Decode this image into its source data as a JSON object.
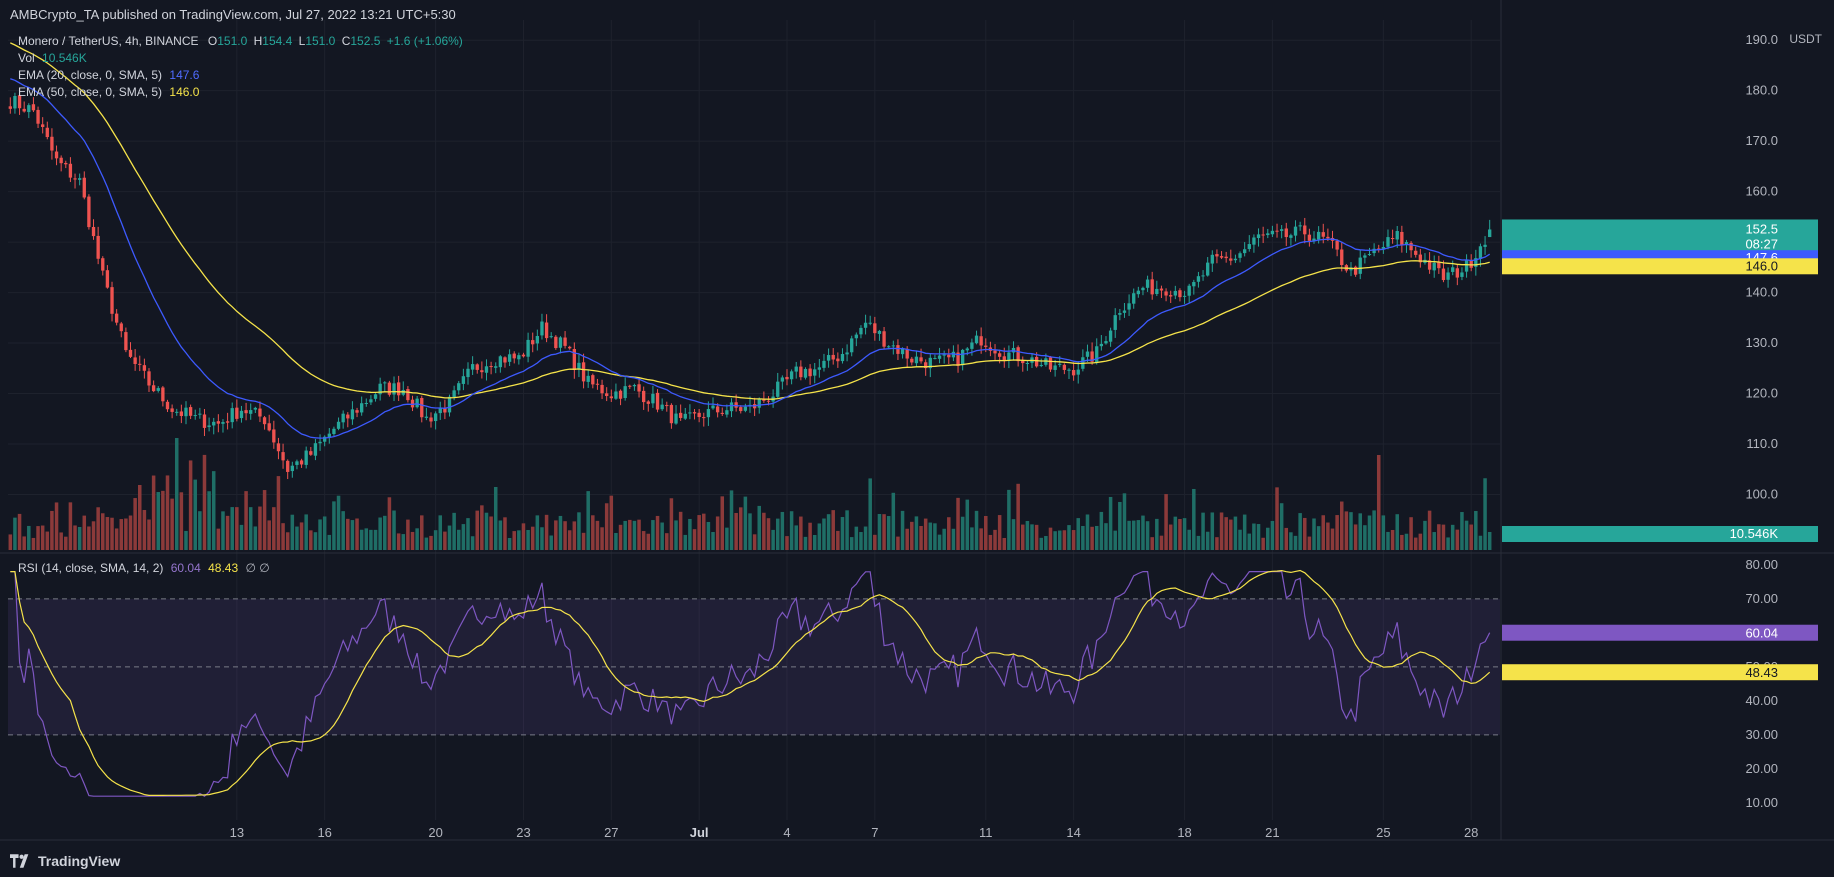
{
  "header": {
    "publisher_line": "AMBCrypto_TA published on TradingView.com, Jul 27, 2022 13:21 UTC+5:30"
  },
  "legend": {
    "symbol": "Monero / TetherUS, 4h, BINANCE",
    "O_label": "O",
    "O": "151.0",
    "H_label": "H",
    "H": "154.4",
    "L_label": "L",
    "L": "151.0",
    "C_label": "C",
    "C": "152.5",
    "change": "+1.6 (+1.06%)",
    "vol_label": "Vol",
    "vol": "10.546K",
    "ema20_label": "EMA (20, close, 0, SMA, 5)",
    "ema20": "147.6",
    "ema50_label": "EMA (50, close, 0, SMA, 5)",
    "ema50": "146.0",
    "rsi_label": "RSI (14, close, SMA, 14, 2)",
    "rsi": "60.04",
    "rsi_ma": "48.43",
    "rsi_extra": "∅ ∅"
  },
  "axis": {
    "currency": "USDT"
  },
  "price_badges": {
    "last": "152.5",
    "countdown": "08:27",
    "ema20": "147.6",
    "ema50": "146.0",
    "volume": "10.546K"
  },
  "rsi_badges": {
    "rsi": "60.04",
    "rsi_ma": "48.43"
  },
  "footer": {
    "brand": "TradingView"
  },
  "colors": {
    "up": "#26a69a",
    "down": "#ef5350",
    "ema20": "#3d5afe",
    "ema50": "#f5e34a",
    "rsi": "#7e57c2",
    "rsi_ma": "#f5e34a",
    "background": "#131722",
    "grid": "#1e222d",
    "text": "#b2b5be"
  },
  "chart_data": [
    {
      "type": "candlestick",
      "title": "Monero / TetherUS, 4h, BINANCE",
      "ylabel": "USDT",
      "ylim": [
        89,
        194
      ],
      "grid": true,
      "x_ticks": [
        "13",
        "16",
        "20",
        "23",
        "27",
        "Jul",
        "4",
        "7",
        "11",
        "14",
        "18",
        "21",
        "25",
        "28"
      ],
      "y_ticks": [
        100,
        110,
        120,
        130,
        140,
        150,
        160,
        170,
        180,
        190
      ],
      "anchors_close": [
        [
          0,
          178
        ],
        [
          5,
          176
        ],
        [
          10,
          166
        ],
        [
          15,
          162
        ],
        [
          20,
          143
        ],
        [
          25,
          128
        ],
        [
          30,
          122
        ],
        [
          35,
          117
        ],
        [
          40,
          115
        ],
        [
          45,
          114
        ],
        [
          50,
          117
        ],
        [
          55,
          115
        ],
        [
          60,
          105
        ],
        [
          65,
          108
        ],
        [
          70,
          113
        ],
        [
          75,
          117
        ],
        [
          80,
          121
        ],
        [
          85,
          121
        ],
        [
          90,
          115
        ],
        [
          95,
          118
        ],
        [
          100,
          125
        ],
        [
          105,
          127
        ],
        [
          110,
          127
        ],
        [
          115,
          133
        ],
        [
          120,
          129
        ],
        [
          125,
          122
        ],
        [
          130,
          120
        ],
        [
          135,
          121
        ],
        [
          140,
          118
        ],
        [
          145,
          114
        ],
        [
          150,
          116
        ],
        [
          155,
          117
        ],
        [
          160,
          117
        ],
        [
          165,
          120
        ],
        [
          170,
          124
        ],
        [
          175,
          125
        ],
        [
          180,
          128
        ],
        [
          185,
          134
        ],
        [
          190,
          130
        ],
        [
          195,
          127
        ],
        [
          200,
          126
        ],
        [
          205,
          127
        ],
        [
          210,
          131
        ],
        [
          215,
          128
        ],
        [
          220,
          127
        ],
        [
          225,
          125
        ],
        [
          230,
          125
        ],
        [
          235,
          128
        ],
        [
          240,
          137
        ],
        [
          245,
          141
        ],
        [
          250,
          141
        ],
        [
          255,
          140
        ],
        [
          260,
          146
        ],
        [
          265,
          147
        ],
        [
          270,
          151
        ],
        [
          275,
          151
        ],
        [
          280,
          152
        ],
        [
          285,
          150
        ],
        [
          290,
          144
        ],
        [
          295,
          148
        ],
        [
          300,
          151
        ],
        [
          305,
          147
        ],
        [
          310,
          143
        ],
        [
          315,
          145
        ],
        [
          320,
          152.5
        ]
      ],
      "last_close": 152.5,
      "volume_last": "10.546K",
      "ema20_last": 147.6,
      "ema50_last": 146.0
    },
    {
      "type": "line",
      "title": "RSI (14, close, SMA, 14, 2)",
      "ylim": [
        5,
        82
      ],
      "y_ticks": [
        10,
        20,
        30,
        40,
        50,
        60,
        70,
        80
      ],
      "bands": [
        30,
        50,
        70
      ],
      "series": [
        {
          "name": "RSI",
          "last": 60.04
        },
        {
          "name": "RSI MA",
          "last": 48.43
        }
      ]
    }
  ]
}
